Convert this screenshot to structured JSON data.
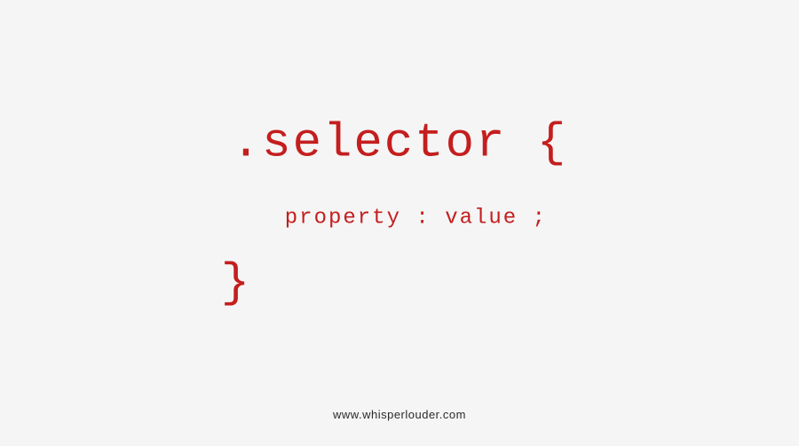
{
  "code": {
    "selector_line": ".selector {",
    "property_line": "property : value ;",
    "close_brace": "}"
  },
  "footer": {
    "url": "www.whisperlouder.com"
  },
  "colors": {
    "text": "#c41e1e",
    "background": "#f5f5f5",
    "footer": "#2a2a2a"
  }
}
